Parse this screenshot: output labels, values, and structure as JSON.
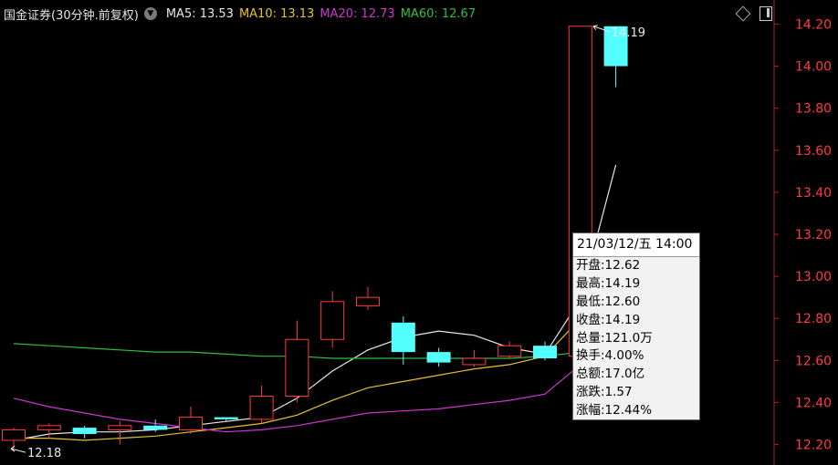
{
  "header": {
    "symbol": "国金证券(30分钟.前复权)",
    "arrow_icon": "circle-down-icon",
    "ma": [
      {
        "label": "MA5: 13.53",
        "color": "#e8e8e8"
      },
      {
        "label": "MA10: 13.13",
        "color": "#e6c229"
      },
      {
        "label": "MA20: 12.73",
        "color": "#d234d2"
      },
      {
        "label": "MA60: 12.67",
        "color": "#2fbf3a"
      }
    ]
  },
  "toolbar": {
    "diamond_icon": "diamond-icon",
    "panel_icon": "panel-toggle-icon"
  },
  "tooltip": {
    "title": "21/03/12/五 14:00",
    "rows": [
      "开盘:12.62",
      "最高:14.19",
      "最低:12.60",
      "收盘:14.19",
      "总量:121.0万",
      "换手:4.00%",
      "总额:17.0亿",
      "涨跌:1.57",
      "涨幅:12.44%"
    ]
  },
  "chart_data": {
    "type": "candlestick",
    "ylim": [
      12.12,
      14.28
    ],
    "y_ticks": [
      "12.20",
      "12.40",
      "12.60",
      "12.80",
      "13.00",
      "13.20",
      "13.40",
      "13.60",
      "13.80",
      "14.00",
      "14.20"
    ],
    "up_color": "#ff3b3b",
    "down_color": "#54ffff",
    "candles": [
      {
        "o": 12.22,
        "h": 12.28,
        "l": 12.18,
        "c": 12.27
      },
      {
        "o": 12.27,
        "h": 12.3,
        "l": 12.23,
        "c": 12.29
      },
      {
        "o": 12.28,
        "h": 12.29,
        "l": 12.23,
        "c": 12.25
      },
      {
        "o": 12.27,
        "h": 12.31,
        "l": 12.2,
        "c": 12.29
      },
      {
        "o": 12.29,
        "h": 12.32,
        "l": 12.26,
        "c": 12.27
      },
      {
        "o": 12.27,
        "h": 12.38,
        "l": 12.25,
        "c": 12.33
      },
      {
        "o": 12.33,
        "h": 12.33,
        "l": 12.31,
        "c": 12.32
      },
      {
        "o": 12.32,
        "h": 12.48,
        "l": 12.3,
        "c": 12.43
      },
      {
        "o": 12.43,
        "h": 12.79,
        "l": 12.4,
        "c": 12.7
      },
      {
        "o": 12.7,
        "h": 12.93,
        "l": 12.66,
        "c": 12.88
      },
      {
        "o": 12.86,
        "h": 12.95,
        "l": 12.84,
        "c": 12.9
      },
      {
        "o": 12.78,
        "h": 12.81,
        "l": 12.58,
        "c": 12.64
      },
      {
        "o": 12.64,
        "h": 12.66,
        "l": 12.57,
        "c": 12.59
      },
      {
        "o": 12.58,
        "h": 12.65,
        "l": 12.57,
        "c": 12.61
      },
      {
        "o": 12.62,
        "h": 12.69,
        "l": 12.61,
        "c": 12.67
      },
      {
        "o": 12.67,
        "h": 12.69,
        "l": 12.6,
        "c": 12.61
      },
      {
        "o": 12.62,
        "h": 14.19,
        "l": 12.6,
        "c": 14.19
      },
      {
        "o": 14.19,
        "h": 14.19,
        "l": 13.9,
        "c": 14.0
      }
    ],
    "series": [
      {
        "name": "MA5",
        "color": "#e8e8e8",
        "values": [
          12.22,
          12.25,
          12.26,
          12.26,
          12.27,
          12.29,
          12.31,
          12.33,
          12.42,
          12.55,
          12.65,
          12.71,
          12.74,
          12.72,
          12.66,
          12.63,
          12.89,
          13.53
        ]
      },
      {
        "name": "MA10",
        "color": "#e6c229",
        "values": [
          12.23,
          12.23,
          12.22,
          12.23,
          12.24,
          12.26,
          12.28,
          12.3,
          12.34,
          12.41,
          12.47,
          12.5,
          12.53,
          12.56,
          12.58,
          12.62,
          12.8,
          13.13
        ]
      },
      {
        "name": "MA20",
        "color": "#d234d2",
        "values": [
          12.42,
          12.38,
          12.35,
          12.32,
          12.3,
          12.28,
          12.26,
          12.27,
          12.29,
          12.32,
          12.35,
          12.36,
          12.37,
          12.39,
          12.41,
          12.44,
          12.58,
          12.73
        ]
      },
      {
        "name": "MA60",
        "color": "#2fbf3a",
        "values": [
          12.68,
          12.67,
          12.66,
          12.65,
          12.64,
          12.64,
          12.63,
          12.62,
          12.62,
          12.61,
          12.61,
          12.61,
          12.61,
          12.61,
          12.61,
          12.62,
          12.64,
          12.67
        ]
      }
    ],
    "annotations": {
      "high_label": "14.19",
      "low_label": "12.18"
    }
  }
}
